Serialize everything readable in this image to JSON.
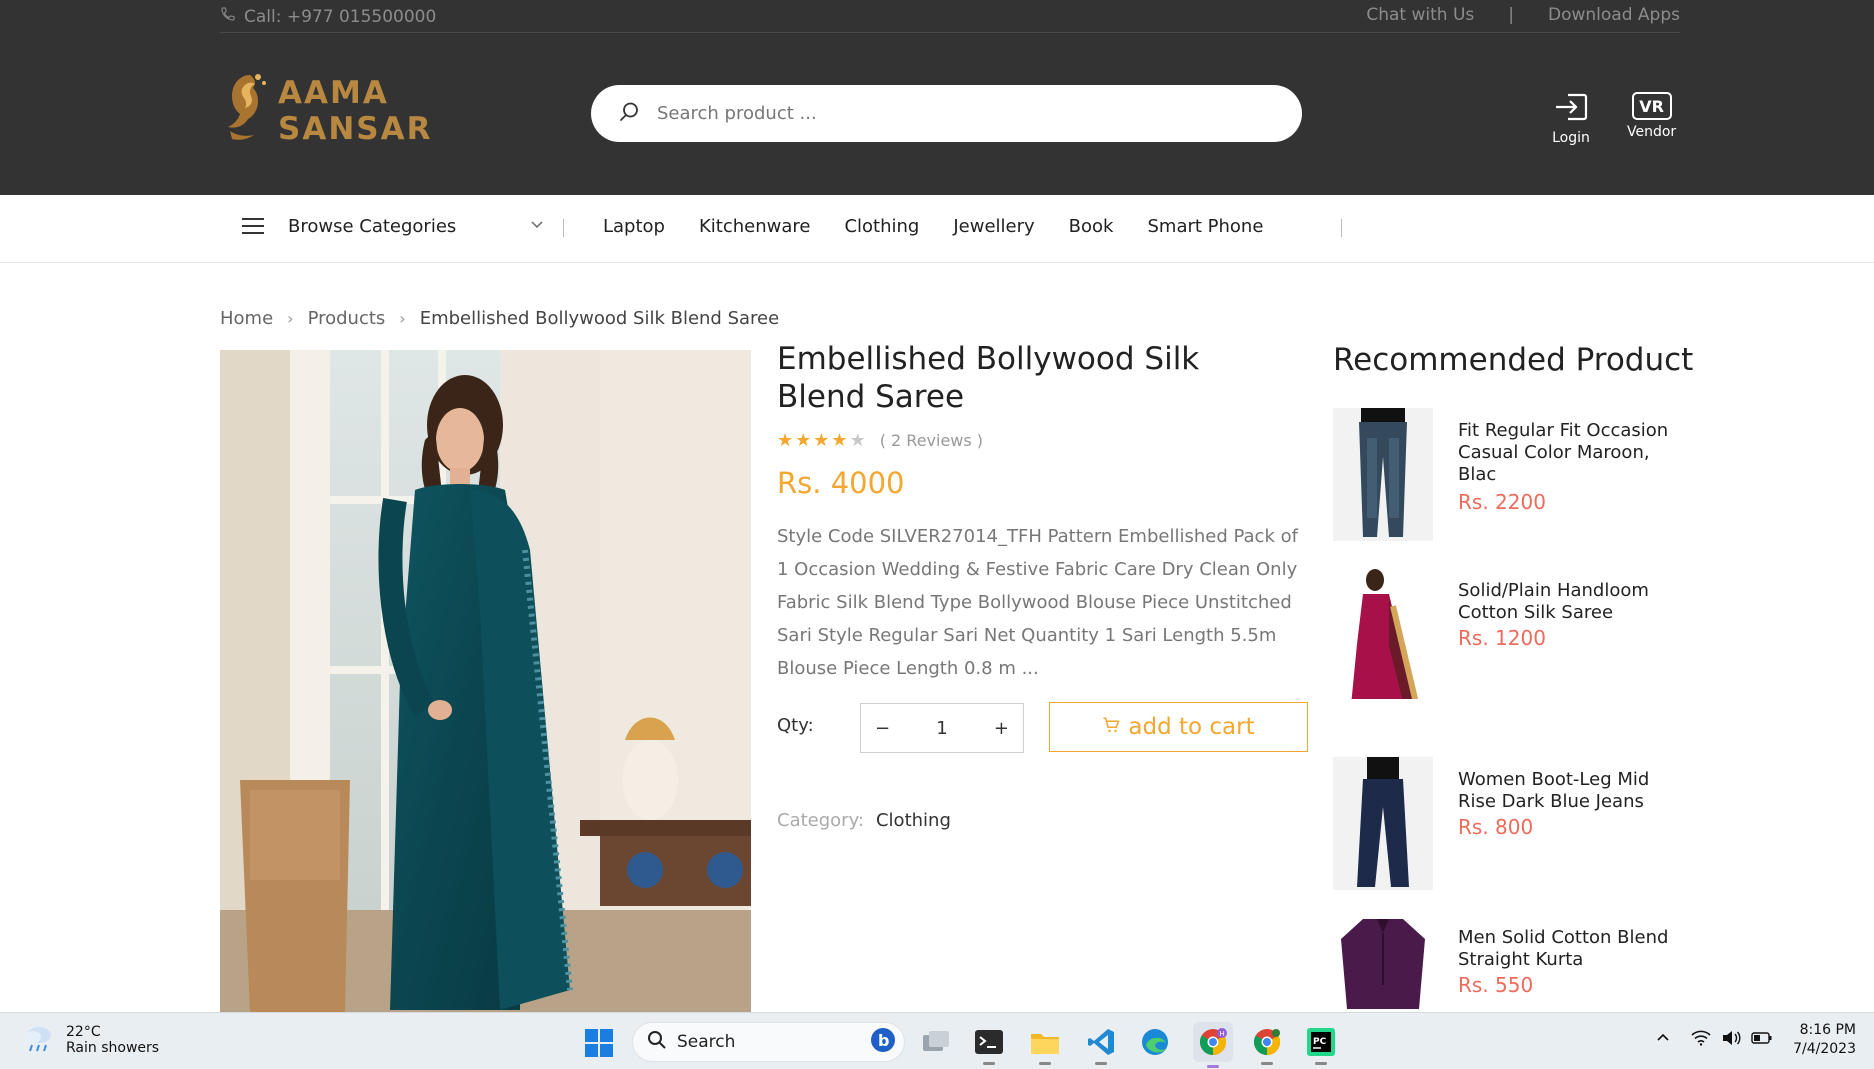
{
  "topbar": {
    "call": "Call: +977 015500000",
    "chat": "Chat with Us",
    "separator": "|",
    "download": "Download Apps"
  },
  "header": {
    "logo_text": "AAMA SANSAR",
    "search_placeholder": "Search product ...",
    "login_label": "Login",
    "vendor_badge": "VR",
    "vendor_label": "Vendor"
  },
  "nav": {
    "browse_label": "Browse Categories",
    "links": [
      "Laptop",
      "Kitchenware",
      "Clothing",
      "Jewellery",
      "Book",
      "Smart Phone"
    ]
  },
  "breadcrumb": {
    "home": "Home",
    "products": "Products",
    "current": "Embellished Bollywood Silk Blend Saree"
  },
  "product": {
    "title": "Embellished Bollywood Silk Blend Saree",
    "rating": 4,
    "rating_max": 5,
    "reviews": "( 2 Reviews )",
    "price": "Rs. 4000",
    "description": "Style Code SILVER27014_TFH Pattern Embellished Pack of 1 Occasion Wedding & Festive Fabric Care Dry Clean Only Fabric Silk Blend Type Bollywood Blouse Piece Unstitched Sari Style Regular Sari Net Quantity 1 Sari Length 5.5m Blouse Piece Length 0.8 m ...",
    "qty_label": "Qty:",
    "qty_minus": "−",
    "qty_value": "1",
    "qty_plus": "+",
    "add_to_cart": "add to cart",
    "category_label": "Category:",
    "category_value": "Clothing"
  },
  "recommended": {
    "title": "Recommended Product",
    "items": [
      {
        "name": "Fit Regular Fit Occasion Casual Color Maroon, Blac",
        "price": "Rs. 2200"
      },
      {
        "name": "Solid/Plain Handloom Cotton Silk Saree",
        "price": "Rs. 1200"
      },
      {
        "name": "Women Boot-Leg Mid Rise Dark Blue Jeans",
        "price": "Rs. 800"
      },
      {
        "name": "Men Solid Cotton Blend Straight Kurta",
        "price": "Rs. 550"
      }
    ]
  },
  "taskbar": {
    "temp": "22°C",
    "weather": "Rain showers",
    "search_label": "Search",
    "time": "8:16 PM",
    "date": "7/4/2023"
  },
  "colors": {
    "header_bg": "#333333",
    "accent_orange": "#f3a72e",
    "rec_price_red": "#ee6b5b",
    "logo_gold": "#b98840"
  }
}
